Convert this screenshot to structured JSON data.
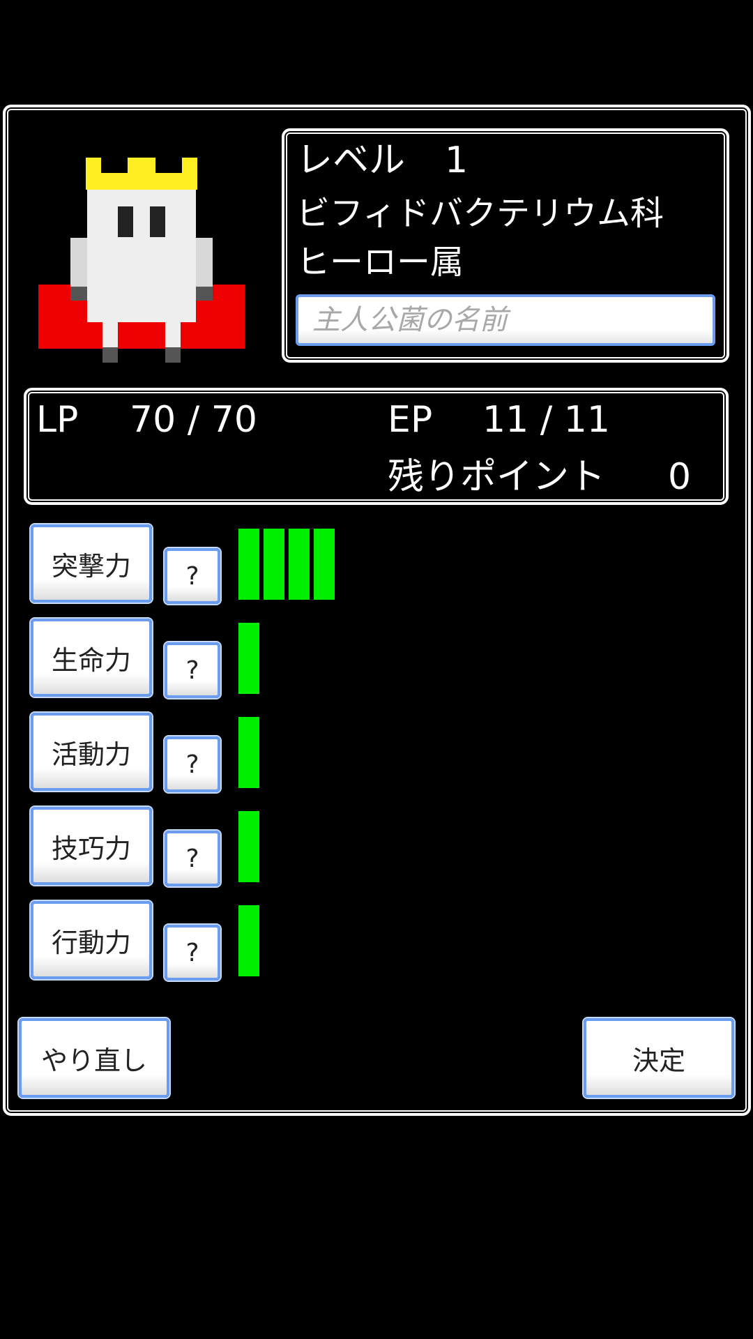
{
  "profile": {
    "level_label": "レベル",
    "level_value": "1",
    "family": "ビフィドバクテリウム科",
    "genus": "ヒーロー属",
    "name_placeholder": "主人公菌の名前"
  },
  "stats": {
    "lp_label": "LP",
    "lp_value": "70 / 70",
    "ep_label": "EP",
    "ep_value": "11 / 11",
    "remaining_label": "残りポイント",
    "remaining_value": "0"
  },
  "attributes": [
    {
      "label": "突撃力",
      "help": "?",
      "level": 4
    },
    {
      "label": "生命力",
      "help": "?",
      "level": 1
    },
    {
      "label": "活動力",
      "help": "?",
      "level": 1
    },
    {
      "label": "技巧力",
      "help": "?",
      "level": 1
    },
    {
      "label": "行動力",
      "help": "?",
      "level": 1
    }
  ],
  "actions": {
    "reset_label": "やり直し",
    "confirm_label": "決定"
  },
  "colors": {
    "bar": "#00ee00",
    "button_border": "#6a9cf0",
    "crown": "#ffee22",
    "cape": "#ee0000"
  },
  "icons": {
    "hero": "hero-sprite-icon"
  }
}
